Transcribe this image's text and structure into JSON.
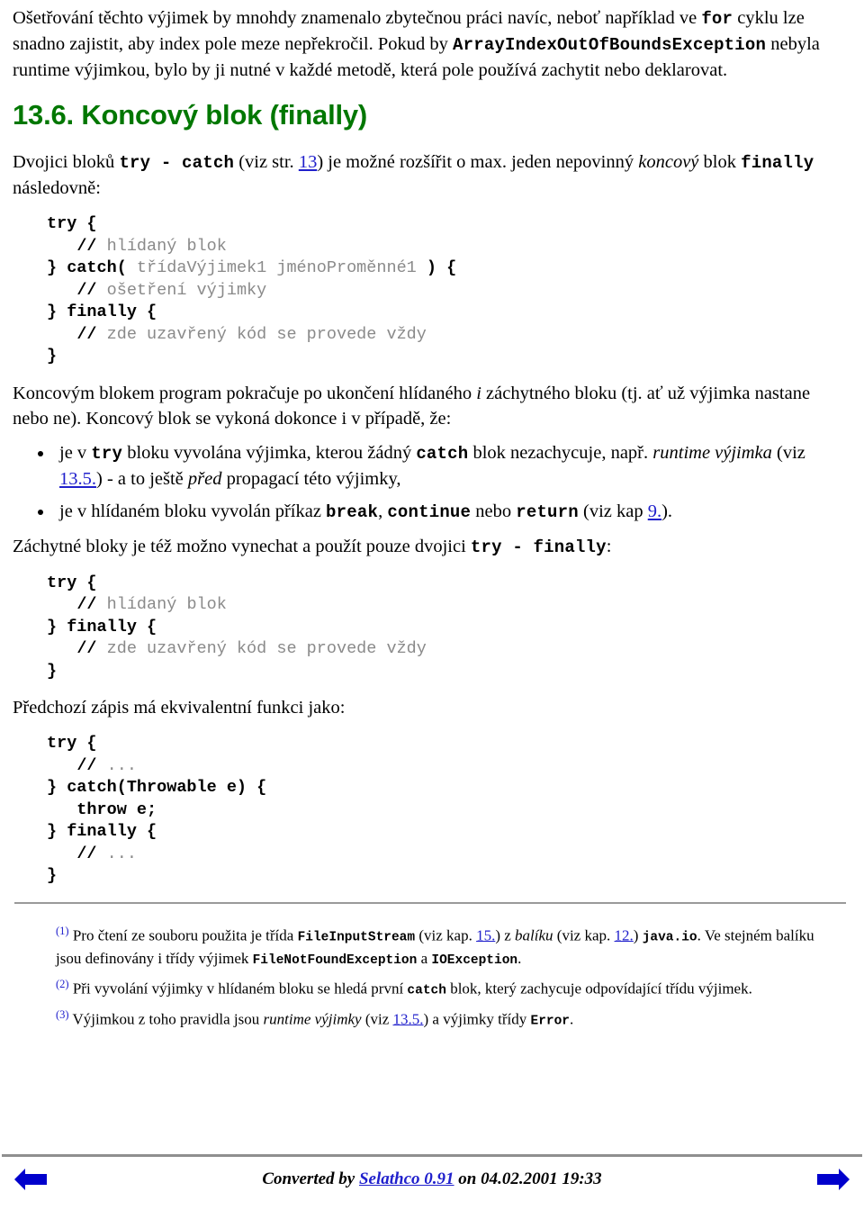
{
  "colors": {
    "heading_green": "#007700",
    "link_blue": "#2020cc",
    "comment_gray": "#8a8a8a",
    "rule_gray": "#8f8f8f"
  },
  "intro": {
    "line1_a": "Ošetřování těchto výjimek by mnohdy znamenalo zbytečnou práci navíc, neboť například ve ",
    "kw_for": "for",
    "line1_b": " cyklu lze snadno zajistit, aby index pole meze nepřekročil. Pokud by ",
    "kw_exception": "ArrayIndexOutOfBoundsException",
    "line1_c": " nebyla runtime výjimkou, bylo by ji nutné v každé metodě, která pole používá zachytit nebo deklarovat."
  },
  "heading": "13.6. Koncový blok (finally)",
  "lead": {
    "a": "Dvojici bloků ",
    "kw_try_catch": "try - catch",
    "b": " (viz str. ",
    "link_13": "13",
    "c": ") je možné rozšířit o max. jeden nepovinný ",
    "italic_koncovy": "koncový",
    "d": " blok ",
    "kw_finally": "finally",
    "e": " následovně:"
  },
  "code1": {
    "lines": [
      [
        {
          "t": "try {",
          "s": "kw"
        }
      ],
      [
        {
          "t": "   ",
          "s": "pl"
        },
        {
          "t": "// ",
          "s": "kw"
        },
        {
          "t": "hlídaný blok",
          "s": "cmt"
        }
      ],
      [
        {
          "t": "} catch(",
          "s": "kw"
        },
        {
          "t": " třídaVýjimek1 jménoProměnné1 ",
          "s": "cmt"
        },
        {
          "t": ") {",
          "s": "kw"
        }
      ],
      [
        {
          "t": "   ",
          "s": "pl"
        },
        {
          "t": "// ",
          "s": "kw"
        },
        {
          "t": "ošetření výjimky",
          "s": "cmt"
        }
      ],
      [
        {
          "t": "} finally {",
          "s": "kw"
        }
      ],
      [
        {
          "t": "   ",
          "s": "pl"
        },
        {
          "t": "// ",
          "s": "kw"
        },
        {
          "t": "zde uzavřený kód se provede vždy",
          "s": "cmt"
        }
      ],
      [
        {
          "t": "}",
          "s": "kw"
        }
      ]
    ]
  },
  "para_koncovym": {
    "a": "Koncovým blokem program pokračuje po ukončení hlídaného ",
    "italic_i": "i",
    "b": " záchytného bloku (tj. ať už výjimka nastane nebo ne). Koncový blok se vykoná dokonce i v případě, že:"
  },
  "bullets": [
    {
      "a": "je v ",
      "kw1": "try",
      "b": " bloku vyvolána výjimka, kterou žádný ",
      "kw2": "catch",
      "c": " blok nezachycuje, např. ",
      "italic1": "runtime výjimka",
      "d": " (viz ",
      "link": "13.5.",
      "e": ") - a to ještě ",
      "italic2": "před",
      "f": " propagací této výjimky,"
    },
    {
      "a": "je v hlídaném bloku vyvolán příkaz ",
      "kw1": "break",
      "b": ", ",
      "kw2": "continue",
      "c": " nebo ",
      "kw3": "return",
      "d": " (viz kap ",
      "link": "9.",
      "e": ")."
    }
  ],
  "para_zachytne": {
    "a": "Záchytné bloky je též možno vynechat a použít pouze dvojici ",
    "kw": "try - finally",
    "b": ":"
  },
  "code2": {
    "lines": [
      [
        {
          "t": "try {",
          "s": "kw"
        }
      ],
      [
        {
          "t": "   ",
          "s": "pl"
        },
        {
          "t": "// ",
          "s": "kw"
        },
        {
          "t": "hlídaný blok",
          "s": "cmt"
        }
      ],
      [
        {
          "t": "} finally {",
          "s": "kw"
        }
      ],
      [
        {
          "t": "   ",
          "s": "pl"
        },
        {
          "t": "// ",
          "s": "kw"
        },
        {
          "t": "zde uzavřený kód se provede vždy",
          "s": "cmt"
        }
      ],
      [
        {
          "t": "}",
          "s": "kw"
        }
      ]
    ]
  },
  "para_prechozi": "Předchozí zápis má ekvivalentní funkci jako:",
  "code3": {
    "lines": [
      [
        {
          "t": "try {",
          "s": "kw"
        }
      ],
      [
        {
          "t": "   ",
          "s": "pl"
        },
        {
          "t": "// ",
          "s": "kw"
        },
        {
          "t": "...",
          "s": "cmt"
        }
      ],
      [
        {
          "t": "} catch(Throwable e) {",
          "s": "kw"
        }
      ],
      [
        {
          "t": "   throw e;",
          "s": "kw"
        }
      ],
      [
        {
          "t": "} finally {",
          "s": "kw"
        }
      ],
      [
        {
          "t": "   ",
          "s": "pl"
        },
        {
          "t": "// ",
          "s": "kw"
        },
        {
          "t": "...",
          "s": "cmt"
        }
      ],
      [
        {
          "t": "}",
          "s": "kw"
        }
      ]
    ]
  },
  "footnotes": [
    {
      "mark": "(1)",
      "a": " Pro čtení ze souboru použita je třída ",
      "mono1": "FileInputStream",
      "b": " (viz kap. ",
      "link1": "15.",
      "c": ") z ",
      "italic1": "balíku",
      "d": " (viz kap. ",
      "link2": "12.",
      "e": ") ",
      "mono2": "java.io",
      "f": ". Ve stejném balíku jsou definovány i třídy výjimek ",
      "mono3": "FileNotFoundException",
      "g": " a ",
      "mono4": "IOException",
      "h": "."
    },
    {
      "mark": "(2)",
      "a": " Při vyvolání výjimky v hlídaném bloku se hledá první ",
      "mono1": "catch",
      "b": " blok, který zachycuje odpovídající třídu výjimek."
    },
    {
      "mark": "(3)",
      "a": " Výjimkou z toho pravidla jsou ",
      "italic1": "runtime výjimky",
      "b": " (viz ",
      "link1": "13.5.",
      "c": ") a výjimky třídy ",
      "mono1": "Error",
      "d": "."
    }
  ],
  "footer": {
    "prefix": "Converted by ",
    "link": "Selathco 0.91",
    "suffix": " on 04.02.2001 19:33",
    "prev_label": "prev-page-arrow",
    "next_label": "next-page-arrow"
  }
}
